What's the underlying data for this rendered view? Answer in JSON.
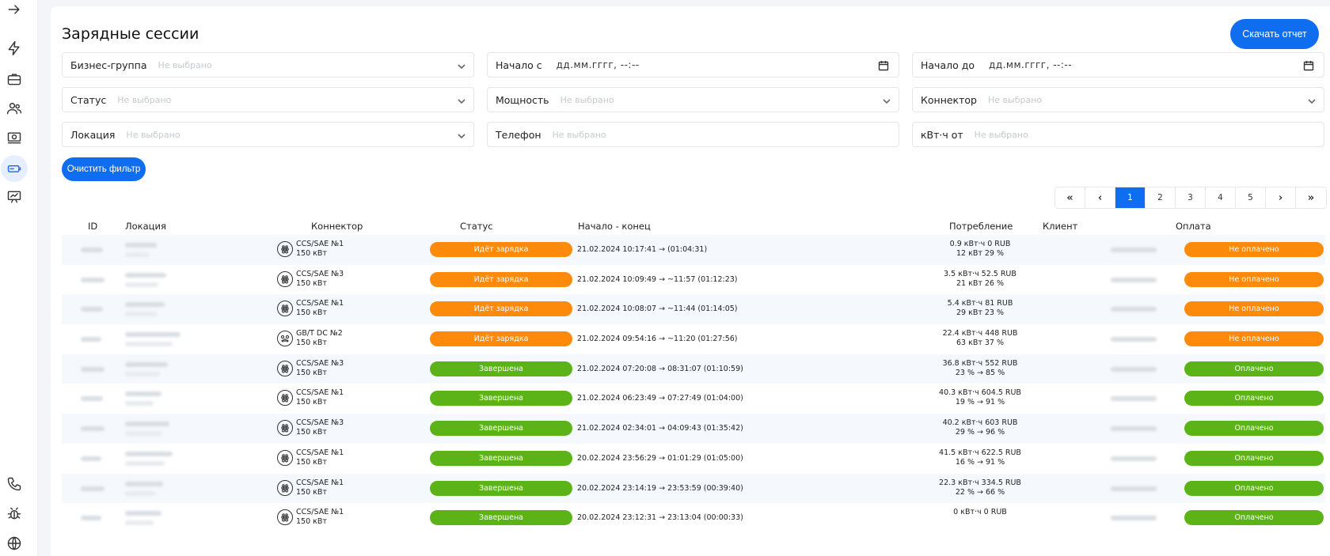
{
  "page": {
    "title": "Зарядные сессии",
    "download_button": "Скачать отчет",
    "clear_filter_button": "Очистить фильтр"
  },
  "filters": {
    "business_group": {
      "label": "Бизнес-группа",
      "placeholder": "Не выбрано"
    },
    "start_from": {
      "label": "Начало с",
      "value": "дд.мм.гггг, --:--"
    },
    "start_to": {
      "label": "Начало до",
      "value": "дд.мм.гггг, --:--"
    },
    "status": {
      "label": "Статус",
      "placeholder": "Не выбрано"
    },
    "power": {
      "label": "Мощность",
      "placeholder": "Не выбрано"
    },
    "connector": {
      "label": "Коннектор",
      "placeholder": "Не выбрано"
    },
    "location": {
      "label": "Локация",
      "placeholder": "Не выбрано"
    },
    "phone": {
      "label": "Телефон",
      "placeholder": "Не выбрано"
    },
    "kwh_from": {
      "label": "кВт·ч от",
      "placeholder": "Не выбрано"
    }
  },
  "pagination": {
    "first": "«",
    "prev": "‹",
    "pages": [
      "1",
      "2",
      "3",
      "4",
      "5"
    ],
    "current": "1",
    "next": "›",
    "last": "»"
  },
  "table": {
    "columns": {
      "id": "ID",
      "location": "Локация",
      "connector": "Коннектор",
      "status": "Статус",
      "time": "Начало - конец",
      "consumption": "Потребление",
      "client": "Клиент",
      "payment": "Оплата"
    },
    "status_colors": {
      "charging": "#fd8a0a",
      "done": "#5bb318"
    },
    "rows": [
      {
        "connector": "CCS/SAE №1",
        "power": "150 кВт",
        "connector_icon": "ccs-icon",
        "status": "Идёт зарядка",
        "status_key": "charging",
        "time": "21.02.2024 10:17:41 → (01:04:31)",
        "cons1": "0.9 кВт·ч   0 RUB",
        "cons2": "12 кВт   29 %",
        "payment": "Не оплачено",
        "pay_key": "charging"
      },
      {
        "connector": "CCS/SAE №3",
        "power": "150 кВт",
        "connector_icon": "ccs-icon",
        "status": "Идёт зарядка",
        "status_key": "charging",
        "time": "21.02.2024 10:09:49 → ~11:57 (01:12:23)",
        "cons1": "3.5 кВт·ч   52.5 RUB",
        "cons2": "21 кВт   26 %",
        "payment": "Не оплачено",
        "pay_key": "charging"
      },
      {
        "connector": "CCS/SAE №1",
        "power": "150 кВт",
        "connector_icon": "ccs-icon",
        "status": "Идёт зарядка",
        "status_key": "charging",
        "time": "21.02.2024 10:08:07 → ~11:44 (01:14:05)",
        "cons1": "5.4 кВт·ч   81 RUB",
        "cons2": "29 кВт   23 %",
        "payment": "Не оплачено",
        "pay_key": "charging"
      },
      {
        "connector": "GB/T DC №2",
        "power": "150 кВт",
        "connector_icon": "gbt-icon",
        "status": "Идёт зарядка",
        "status_key": "charging",
        "time": "21.02.2024 09:54:16 → ~11:20 (01:27:56)",
        "cons1": "22.4 кВт·ч   448 RUB",
        "cons2": "63 кВт   37 %",
        "payment": "Не оплачено",
        "pay_key": "charging"
      },
      {
        "connector": "CCS/SAE №3",
        "power": "150 кВт",
        "connector_icon": "ccs-icon",
        "status": "Завершена",
        "status_key": "done",
        "time": "21.02.2024 07:20:08 → 08:31:07 (01:10:59)",
        "cons1": "36.8 кВт·ч   552 RUB",
        "cons2": "23 %  →  85 %",
        "payment": "Оплачено",
        "pay_key": "done"
      },
      {
        "connector": "CCS/SAE №1",
        "power": "150 кВт",
        "connector_icon": "ccs-icon",
        "status": "Завершена",
        "status_key": "done",
        "time": "21.02.2024 06:23:49 → 07:27:49 (01:04:00)",
        "cons1": "40.3 кВт·ч   604.5 RUB",
        "cons2": "19 %  →  91 %",
        "payment": "Оплачено",
        "pay_key": "done"
      },
      {
        "connector": "CCS/SAE №3",
        "power": "150 кВт",
        "connector_icon": "ccs-icon",
        "status": "Завершена",
        "status_key": "done",
        "time": "21.02.2024 02:34:01 → 04:09:43 (01:35:42)",
        "cons1": "40.2 кВт·ч   603 RUB",
        "cons2": "29 %  →  96 %",
        "payment": "Оплачено",
        "pay_key": "done"
      },
      {
        "connector": "CCS/SAE №1",
        "power": "150 кВт",
        "connector_icon": "ccs-icon",
        "status": "Завершена",
        "status_key": "done",
        "time": "20.02.2024 23:56:29 → 01:01:29 (01:05:00)",
        "cons1": "41.5 кВт·ч   622.5 RUB",
        "cons2": "16 %  →  91 %",
        "payment": "Оплачено",
        "pay_key": "done"
      },
      {
        "connector": "CCS/SAE №1",
        "power": "150 кВт",
        "connector_icon": "ccs-icon",
        "status": "Завершена",
        "status_key": "done",
        "time": "20.02.2024 23:14:19 → 23:53:59 (00:39:40)",
        "cons1": "22.3 кВт·ч   334.5 RUB",
        "cons2": "22 %  →  66 %",
        "payment": "Оплачено",
        "pay_key": "done"
      },
      {
        "connector": "CCS/SAE №1",
        "power": "150 кВт",
        "connector_icon": "ccs-icon",
        "status": "Завершена",
        "status_key": "done",
        "time": "20.02.2024 23:12:31 → 23:13:04 (00:00:33)",
        "cons1": "0 кВт·ч   0 RUB",
        "cons2": "",
        "payment": "Оплачено",
        "pay_key": "done"
      }
    ]
  },
  "sidebar": {
    "icons": [
      "arrow-right-icon",
      "lightning-icon",
      "briefcase-icon",
      "users-icon",
      "cash-icon",
      "battery-icon",
      "chart-board-icon",
      "phone-icon",
      "bug-icon",
      "globe-icon"
    ]
  }
}
